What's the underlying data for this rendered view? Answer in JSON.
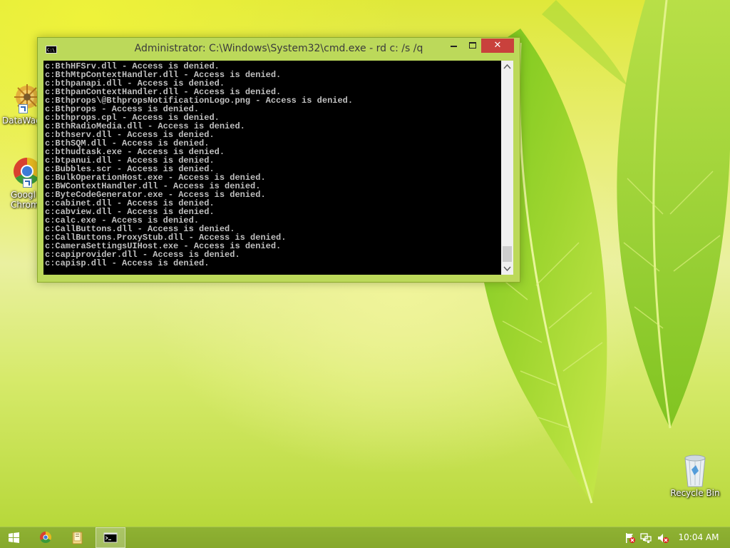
{
  "desktop": {
    "icons": [
      {
        "label": "DataWag",
        "icon": "datawag-icon"
      },
      {
        "label": "Googl\nChrom",
        "icon": "chrome-icon"
      },
      {
        "label": "Recycle Bin",
        "icon": "recycle-bin-icon"
      }
    ]
  },
  "window": {
    "title": "Administrator: C:\\Windows\\System32\\cmd.exe - rd  c: /s /q",
    "icon": "cmd-icon",
    "icon_text": "C:\\",
    "close_label": "✕"
  },
  "console": {
    "lines": [
      "c:BthHFSrv.dll - Access is denied.",
      "c:BthMtpContextHandler.dll - Access is denied.",
      "c:bthpanapi.dll - Access is denied.",
      "c:BthpanContextHandler.dll - Access is denied.",
      "c:Bthprops\\@BthpropsNotificationLogo.png - Access is denied.",
      "c:Bthprops - Access is denied.",
      "c:bthprops.cpl - Access is denied.",
      "c:BthRadioMedia.dll - Access is denied.",
      "c:bthserv.dll - Access is denied.",
      "c:BthSQM.dll - Access is denied.",
      "c:bthudtask.exe - Access is denied.",
      "c:btpanui.dll - Access is denied.",
      "c:Bubbles.scr - Access is denied.",
      "c:BulkOperationHost.exe - Access is denied.",
      "c:BWContextHandler.dll - Access is denied.",
      "c:ByteCodeGenerator.exe - Access is denied.",
      "c:cabinet.dll - Access is denied.",
      "c:cabview.dll - Access is denied.",
      "c:calc.exe - Access is denied.",
      "c:CallButtons.dll - Access is denied.",
      "c:CallButtons.ProxyStub.dll - Access is denied.",
      "c:CameraSettingsUIHost.exe - Access is denied.",
      "c:capiprovider.dll - Access is denied.",
      "c:capisp.dll - Access is denied."
    ]
  },
  "taskbar": {
    "items": [
      "start-icon",
      "chrome-icon",
      "file-explorer-icon",
      "cmd-icon"
    ],
    "tray": [
      "action-center-flag-icon",
      "network-icon",
      "volume-muted-icon"
    ],
    "clock": "10:04 AM"
  },
  "colors": {
    "window_frame": "#bcd95a",
    "console_bg": "#000000",
    "console_text": "#c0c0c0",
    "close_button": "#c9413c",
    "taskbar": "#8fb233"
  }
}
